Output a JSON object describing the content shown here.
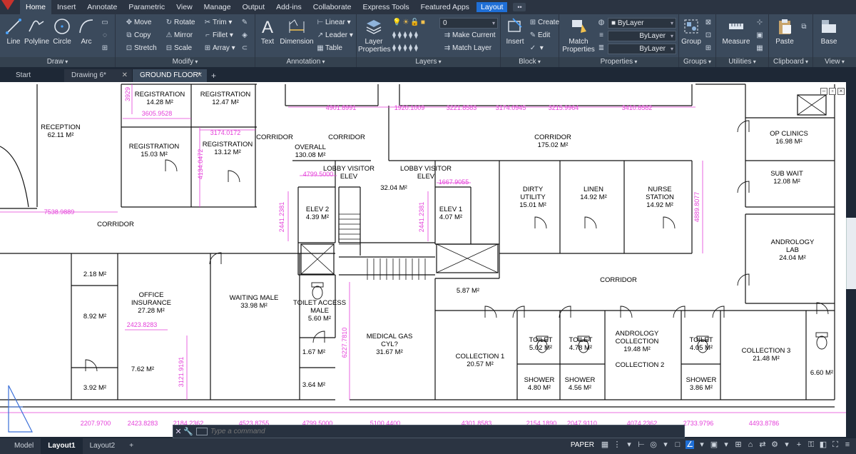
{
  "ribbon_tabs": [
    "Home",
    "Insert",
    "Annotate",
    "Parametric",
    "View",
    "Manage",
    "Output",
    "Add-ins",
    "Collaborate",
    "Express Tools",
    "Featured Apps",
    "Layout"
  ],
  "active_tab": "Home",
  "panels": {
    "draw": {
      "title": "Draw",
      "line": "Line",
      "polyline": "Polyline",
      "circle": "Circle",
      "arc": "Arc"
    },
    "modify": {
      "title": "Modify",
      "move": "Move",
      "rotate": "Rotate",
      "trim": "Trim",
      "copy": "Copy",
      "mirror": "Mirror",
      "fillet": "Fillet",
      "stretch": "Stretch",
      "scale": "Scale",
      "array": "Array"
    },
    "annotation": {
      "title": "Annotation",
      "text": "Text",
      "dimension": "Dimension",
      "linear": "Linear",
      "leader": "Leader",
      "table": "Table"
    },
    "layers": {
      "title": "Layers",
      "layer_properties": "Layer Properties",
      "current_layer": "0",
      "make_current": "Make Current",
      "match_layer": "Match Layer"
    },
    "block": {
      "title": "Block",
      "insert": "Insert",
      "create": "Create",
      "edit": "Edit"
    },
    "properties": {
      "title": "Properties",
      "match_properties": "Match Properties",
      "color": "ByLayer",
      "linetype": "ByLayer",
      "lineweight": "ByLayer"
    },
    "groups": {
      "title": "Groups",
      "group": "Group"
    },
    "utilities": {
      "title": "Utilities",
      "measure": "Measure"
    },
    "clipboard": {
      "title": "Clipboard",
      "paste": "Paste"
    },
    "view": {
      "title": "View",
      "base": "Base"
    }
  },
  "file_tabs": {
    "start": "Start",
    "drawing": "Drawing 6*",
    "ground_floor": "GROUND FLOOR*"
  },
  "rooms": [
    {
      "name": "RECEPTION",
      "area": "62.11 M²"
    },
    {
      "name": "REGISTRATION",
      "area": "14.28 M²"
    },
    {
      "name": "REGISTRATION",
      "area": "12.47 M²"
    },
    {
      "name": "REGISTRATION",
      "area": "15.03 M²"
    },
    {
      "name": "REGISTRATION",
      "area": "13.12 M²"
    },
    {
      "name": "CORRIDOR",
      "area": ""
    },
    {
      "name": "CORRIDOR",
      "area": ""
    },
    {
      "name": "OVERALL",
      "area": "130.08 M²"
    },
    {
      "name": "CORRIDOR",
      "area": "175.02 M²"
    },
    {
      "name": "LOBBY VISITOR ELEV",
      "area": ""
    },
    {
      "name": "LOBBY VISITOR ELEV",
      "area": ""
    },
    {
      "name": "",
      "area": "32.04 M²"
    },
    {
      "name": "ELEV 2",
      "area": "4.39 M²"
    },
    {
      "name": "ELEV 1",
      "area": "4.07 M²"
    },
    {
      "name": "DIRTY UTILITY",
      "area": "15.01 M²"
    },
    {
      "name": "LINEN",
      "area": "14.92 M²"
    },
    {
      "name": "NURSE STATION",
      "area": "14.92 M²"
    },
    {
      "name": "OP CLINICS",
      "area": "16.98 M²"
    },
    {
      "name": "SUB WAIT",
      "area": "12.08 M²"
    },
    {
      "name": "ANDROLOGY LAB",
      "area": "24.04 M²"
    },
    {
      "name": "CORRIDOR",
      "area": ""
    },
    {
      "name": "CORRIDOR",
      "area": ""
    },
    {
      "name": "",
      "area": "2.18 M²"
    },
    {
      "name": "OFFICE INSURANCE",
      "area": "27.28 M²"
    },
    {
      "name": "WAITING MALE",
      "area": "33.98 M²"
    },
    {
      "name": "TOILET ACCESS MALE",
      "area": "5.60 M²"
    },
    {
      "name": "",
      "area": "8.92 M²"
    },
    {
      "name": "",
      "area": "7.62 M²"
    },
    {
      "name": "",
      "area": "3.92 M²"
    },
    {
      "name": "",
      "area": "1.67 M²"
    },
    {
      "name": "",
      "area": "3.64 M²"
    },
    {
      "name": "MEDICAL GAS CYL?",
      "area": "31.67 M²"
    },
    {
      "name": "",
      "area": "5.87 M²"
    },
    {
      "name": "COLLECTION 1",
      "area": "20.57 M²"
    },
    {
      "name": "TOILET",
      "area": "5.02 M²"
    },
    {
      "name": "TOILET",
      "area": "4.78 M²"
    },
    {
      "name": "ANDROLOGY COLLECTION",
      "area": "19.48 M²"
    },
    {
      "name": "COLLECTION 2",
      "area": ""
    },
    {
      "name": "TOILET",
      "area": "4.05 M²"
    },
    {
      "name": "COLLECTION 3",
      "area": "21.48 M²"
    },
    {
      "name": "",
      "area": "6.60 M²"
    },
    {
      "name": "SHOWER",
      "area": "4.80 M²"
    },
    {
      "name": "SHOWER",
      "area": "4.56 M²"
    },
    {
      "name": "SHOWER",
      "area": "3.86 M²"
    }
  ],
  "dimensions": [
    "4901.8991",
    "1920.1009",
    "3221.8583",
    "3174.0945",
    "3215.9964",
    "3410.8582",
    "3605.9528",
    "3174.0172",
    "7538.9889",
    "4799.5000",
    "1667.9055",
    "2423.8283",
    "2207.9700",
    "2423.8283",
    "2184.2362",
    "4523.8755",
    "4799.5000",
    "5100.4400",
    "4301.8583",
    "2154.1890",
    "2047.9110",
    "4074.2362",
    "2733.9796",
    "4493.8786",
    "4134.0472",
    "2441.2381",
    "2441.2381",
    "4889.8077",
    "3121.9191",
    "6227.7810",
    "3929"
  ],
  "command_placeholder": "Type a command",
  "layout_tabs": [
    "Model",
    "Layout1",
    "Layout2"
  ],
  "active_layout": "Layout1",
  "status": {
    "paper": "PAPER"
  }
}
